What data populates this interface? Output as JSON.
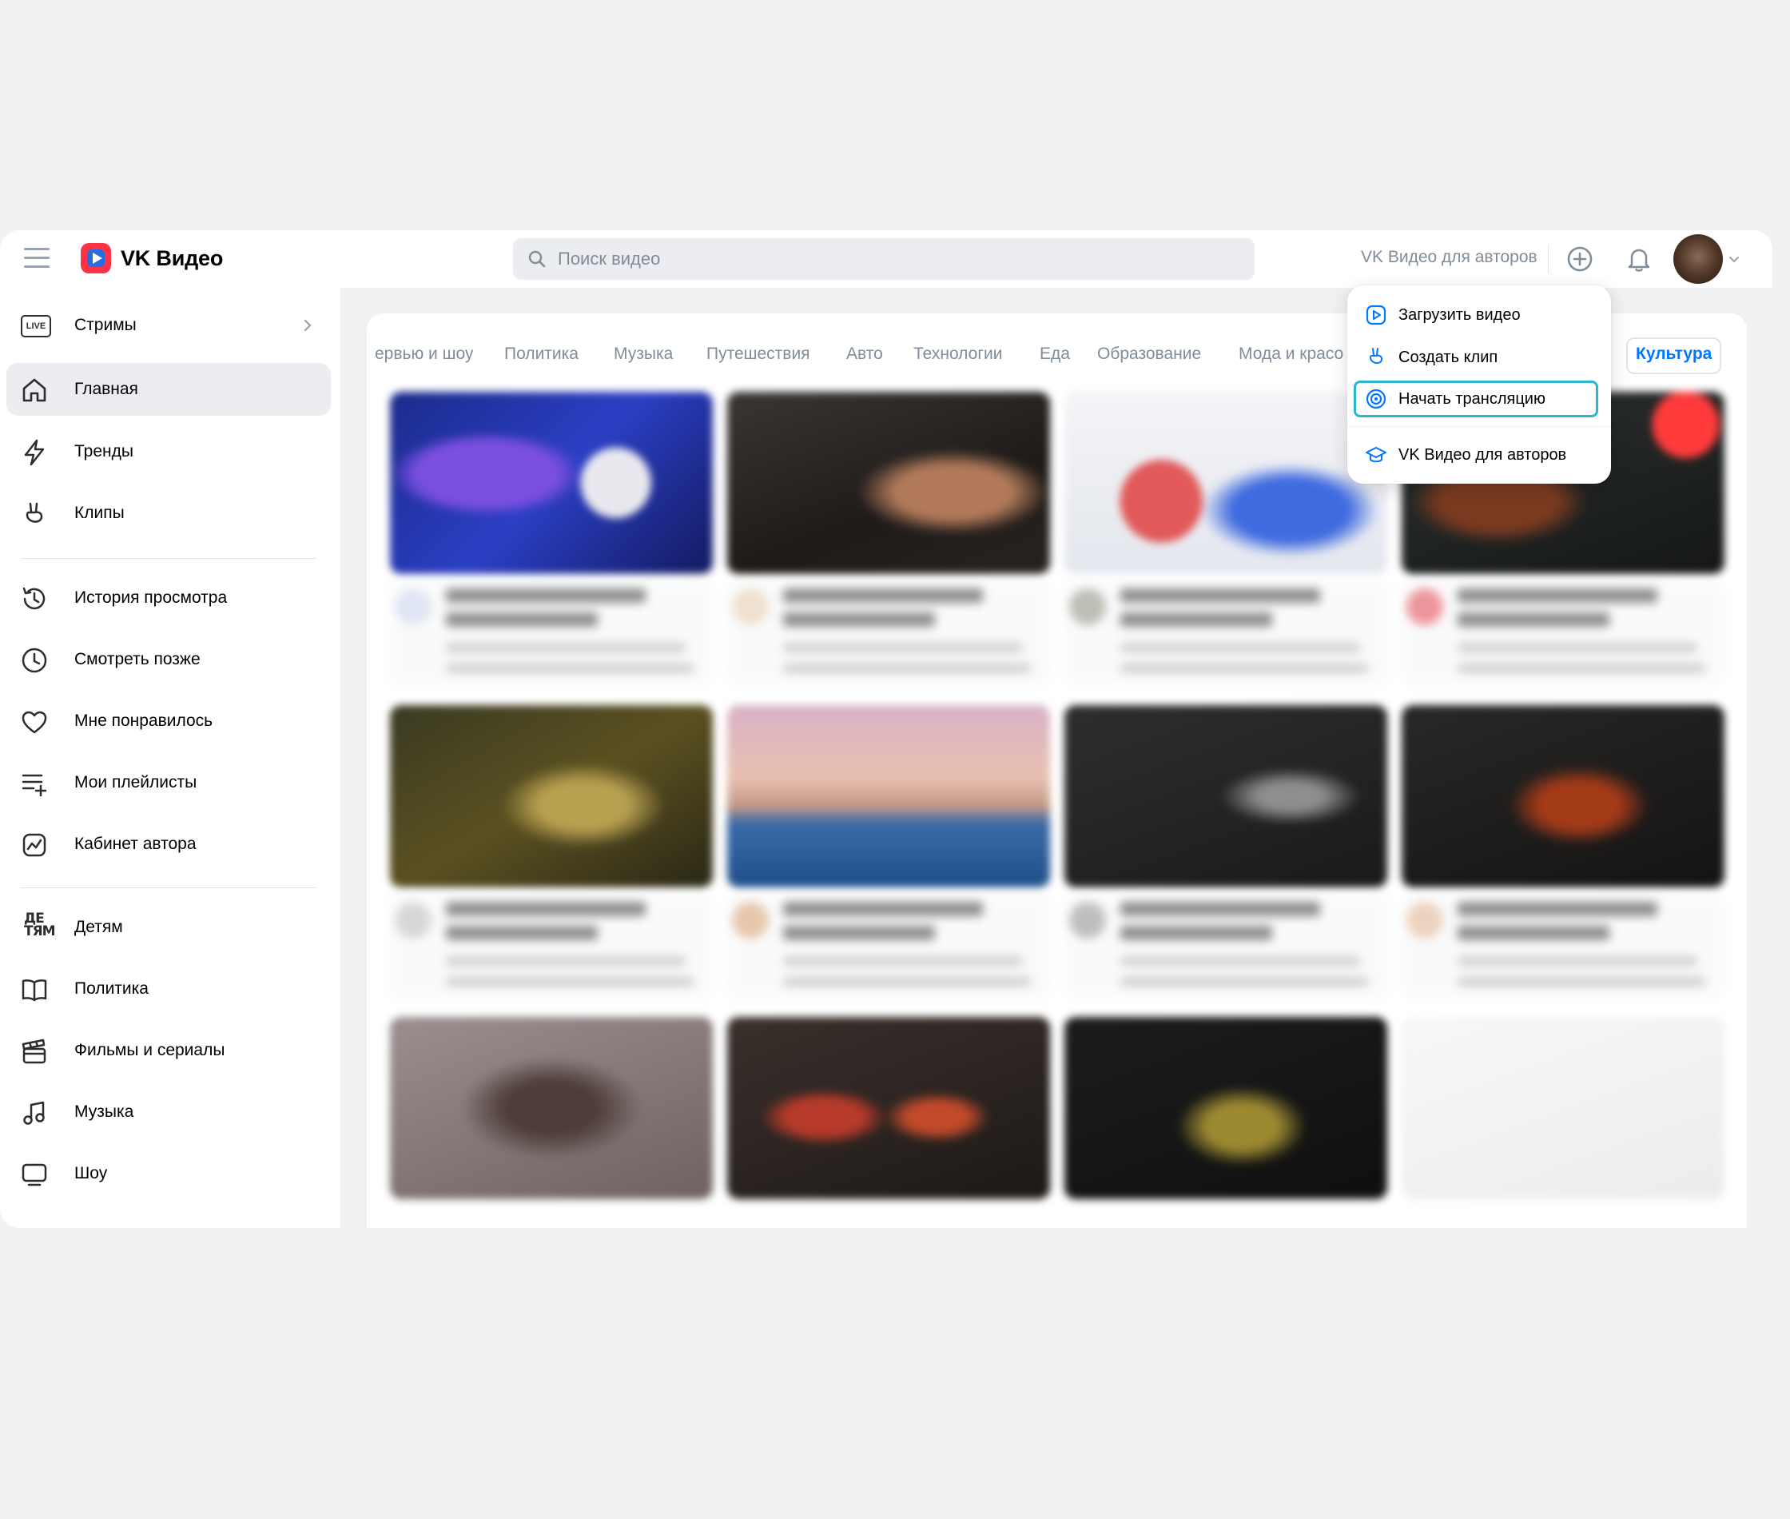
{
  "header": {
    "logo_text": "VK Видео",
    "search_placeholder": "Поиск видео",
    "authors_link": "VK Видео для авторов"
  },
  "sidebar": {
    "items": [
      {
        "label": "Стримы",
        "icon": "live-icon",
        "has_chevron": true
      },
      {
        "label": "Главная",
        "icon": "home-icon",
        "active": true
      },
      {
        "label": "Тренды",
        "icon": "lightning-icon"
      },
      {
        "label": "Клипы",
        "icon": "clip-hand-icon"
      },
      {
        "label": "История просмотра",
        "icon": "history-icon"
      },
      {
        "label": "Смотреть позже",
        "icon": "clock-icon"
      },
      {
        "label": "Мне понравилось",
        "icon": "heart-icon"
      },
      {
        "label": "Мои плейлисты",
        "icon": "playlist-add-icon"
      },
      {
        "label": "Кабинет автора",
        "icon": "analytics-icon"
      },
      {
        "label": "Детям",
        "icon": "kids-icon",
        "icon_text": "ДЕ ТЯМ"
      },
      {
        "label": "Политика",
        "icon": "book-icon"
      },
      {
        "label": "Фильмы и сериалы",
        "icon": "clapperboard-icon"
      },
      {
        "label": "Музыка",
        "icon": "music-note-icon"
      },
      {
        "label": "Шоу",
        "icon": "tv-icon"
      }
    ]
  },
  "categories": [
    "ервью и шоу",
    "Политика",
    "Музыка",
    "Путешествия",
    "Авто",
    "Технологии",
    "Еда",
    "Образование",
    "Мода и красо",
    "Культура"
  ],
  "active_category": "Культура",
  "dropdown": {
    "items": [
      {
        "label": "Загрузить видео",
        "icon": "upload-video-icon"
      },
      {
        "label": "Создать клип",
        "icon": "clip-hand-icon"
      },
      {
        "label": "Начать трансляцию",
        "icon": "broadcast-icon",
        "focused": true
      },
      {
        "label": "VK Видео для авторов",
        "icon": "graduation-cap-icon"
      }
    ]
  },
  "colors": {
    "accent": "#0077ff",
    "focus_ring": "#2ab5d1",
    "logo_red": "#ff3347",
    "muted_text": "#818c99"
  }
}
